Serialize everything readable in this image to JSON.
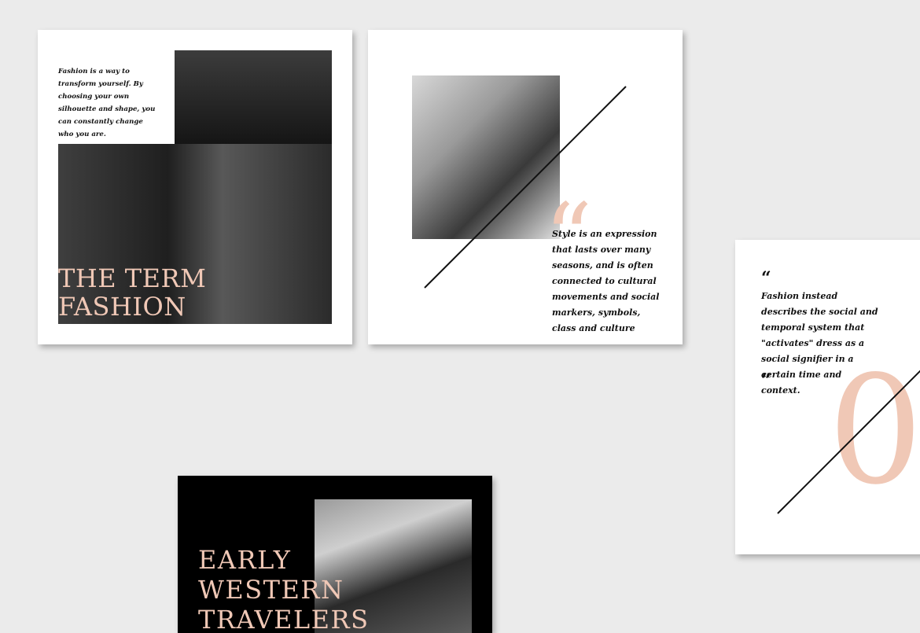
{
  "colors": {
    "background": "#ebebeb",
    "accent_peach": "#f0c8b6",
    "text_dark": "#111111",
    "card_white": "#ffffff",
    "card_black": "#000000"
  },
  "cards": [
    {
      "intro_text": "Fashion is a way to transform yourself. By choosing your own silhouette and shape, you can constantly change who you are.",
      "title_line1": "THE TERM",
      "title_line2": "FASHION"
    },
    {
      "quote_mark": "“",
      "quote_text": "Style is an expression that lasts over many seasons, and is often connected to cultural movements and social markers, symbols, class and culture"
    },
    {
      "open_quote": "“",
      "quote_text": "Fashion instead describes the social and temporal system that \"activates\" dress as a social signifier in a certain time and context.",
      "close_quote": "”",
      "big_numeral": "0"
    },
    {
      "title_line1": "EARLY",
      "title_line2": "WESTERN",
      "title_line3": "TRAVELERS"
    }
  ]
}
